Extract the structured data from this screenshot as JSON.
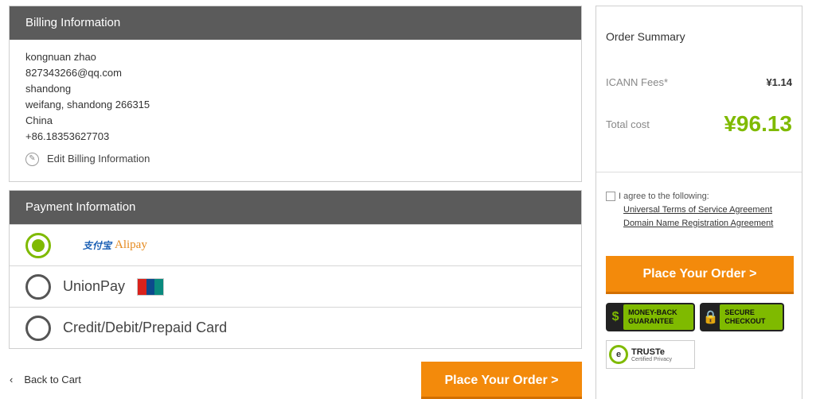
{
  "billing": {
    "title": "Billing Information",
    "lines": [
      "kongnuan zhao",
      "827343266@qq.com",
      "shandong",
      "weifang, shandong  266315",
      "China",
      "+86.18353627703"
    ],
    "edit_label": "Edit Billing Information"
  },
  "payment": {
    "title": "Payment Information",
    "options": [
      {
        "label": "Alipay",
        "logo_mark": "支付宝",
        "selected": true
      },
      {
        "label": "UnionPay",
        "logo_text": "UnionPay 银联",
        "selected": false
      },
      {
        "label": "Credit/Debit/Prepaid Card",
        "selected": false
      }
    ]
  },
  "nav": {
    "back_label": "Back to Cart",
    "back_icon": "chevron-left-icon"
  },
  "summary": {
    "title": "Order Summary",
    "fee_label": "ICANN Fees*",
    "fee_value": "¥1.14",
    "total_label": "Total cost",
    "total_value": "¥96.13",
    "agree_label": "I agree to the following:",
    "links": [
      "Universal Terms of Service Agreement",
      "Domain Name Registration Agreement"
    ],
    "place_order_label": "Place Your Order >",
    "badges": {
      "money_back": "MONEY-BACK GUARANTEE",
      "secure": "SECURE CHECKOUT",
      "truste_name": "TRUSTe",
      "truste_sub": "Certified Privacy"
    },
    "accent_color": "#7fba00",
    "button_color": "#f38a0b"
  },
  "actions": {
    "place_order_label": "Place Your Order >"
  }
}
